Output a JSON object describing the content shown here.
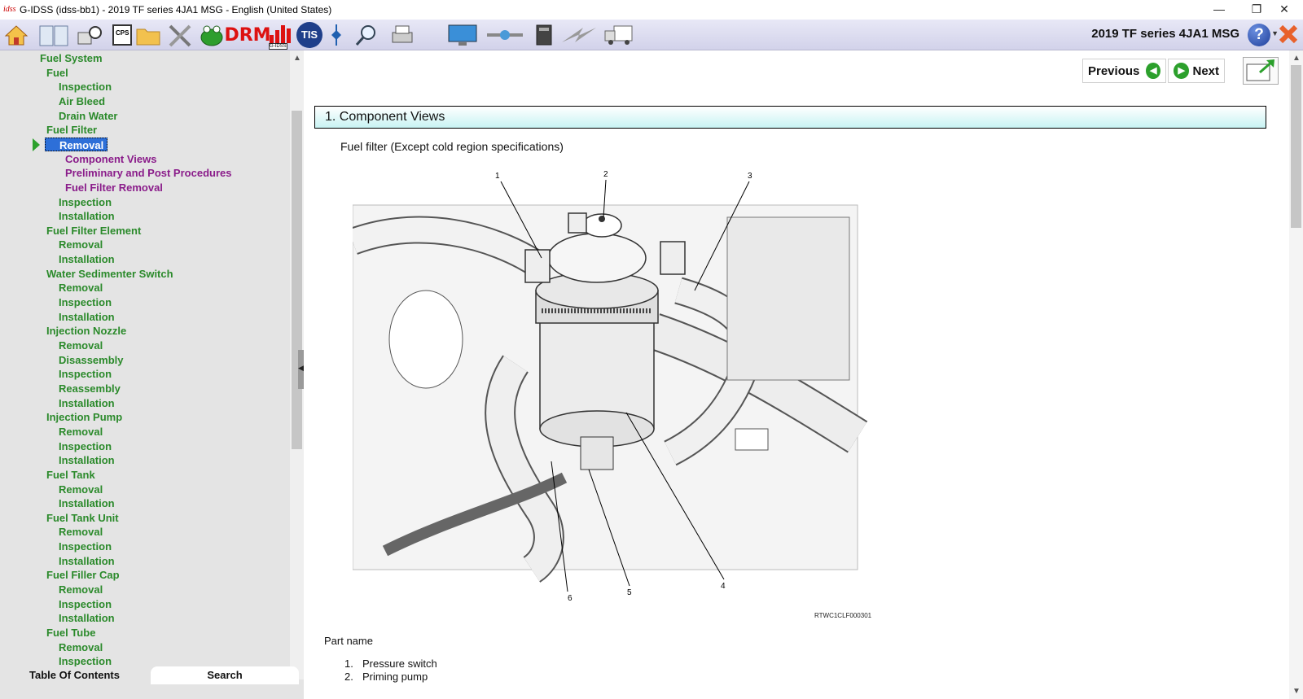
{
  "window": {
    "title": "G-IDSS (idss-bb1) - 2019 TF series 4JA1 MSG - English (United States)",
    "app_icon_text": "idss",
    "minimize": "—",
    "restore": "❐",
    "close": "✕"
  },
  "toolbar": {
    "model_title": "2019 TF series 4JA1 MSG",
    "drm_label": "DRM",
    "tis_label": "TIS",
    "gidss_label": "G-IDSS",
    "cps_label": "CPS",
    "help_label": "?",
    "icons": [
      "home-icon",
      "book-icon",
      "diagnostic-icon",
      "cps-icon",
      "folder-icon",
      "tools-icon",
      "frog-icon",
      "drm-icon",
      "bar-chart-icon",
      "tis-icon",
      "split-icon",
      "magnifier-icon",
      "printer-icon",
      "monitor-icon",
      "transfer-icon",
      "device-icon",
      "lightning-icon",
      "truck-icon"
    ]
  },
  "sidebar": {
    "tree": [
      {
        "label": "Fuel System",
        "level": 0
      },
      {
        "label": "Fuel",
        "level": 1
      },
      {
        "label": "Inspection",
        "level": 2
      },
      {
        "label": "Air Bleed",
        "level": 2
      },
      {
        "label": "Drain Water",
        "level": 2
      },
      {
        "label": "Fuel Filter",
        "level": 1
      },
      {
        "label": "Removal",
        "level": 2,
        "selected": true
      },
      {
        "label": "Component Views",
        "level": 3,
        "color": "purple"
      },
      {
        "label": "Preliminary and Post Procedures",
        "level": 3,
        "color": "purple"
      },
      {
        "label": "Fuel Filter Removal",
        "level": 3,
        "color": "purple"
      },
      {
        "label": "Inspection",
        "level": 2
      },
      {
        "label": "Installation",
        "level": 2
      },
      {
        "label": "Fuel Filter Element",
        "level": 1
      },
      {
        "label": "Removal",
        "level": 2
      },
      {
        "label": "Installation",
        "level": 2
      },
      {
        "label": "Water Sedimenter Switch",
        "level": 1
      },
      {
        "label": "Removal",
        "level": 2
      },
      {
        "label": "Inspection",
        "level": 2
      },
      {
        "label": "Installation",
        "level": 2
      },
      {
        "label": "Injection Nozzle",
        "level": 1
      },
      {
        "label": "Removal",
        "level": 2
      },
      {
        "label": "Disassembly",
        "level": 2
      },
      {
        "label": "Inspection",
        "level": 2
      },
      {
        "label": "Reassembly",
        "level": 2
      },
      {
        "label": "Installation",
        "level": 2
      },
      {
        "label": "Injection Pump",
        "level": 1
      },
      {
        "label": "Removal",
        "level": 2
      },
      {
        "label": "Inspection",
        "level": 2
      },
      {
        "label": "Installation",
        "level": 2
      },
      {
        "label": "Fuel Tank",
        "level": 1
      },
      {
        "label": "Removal",
        "level": 2
      },
      {
        "label": "Installation",
        "level": 2
      },
      {
        "label": "Fuel Tank Unit",
        "level": 1
      },
      {
        "label": "Removal",
        "level": 2
      },
      {
        "label": "Inspection",
        "level": 2
      },
      {
        "label": "Installation",
        "level": 2
      },
      {
        "label": "Fuel Filler Cap",
        "level": 1
      },
      {
        "label": "Removal",
        "level": 2
      },
      {
        "label": "Inspection",
        "level": 2
      },
      {
        "label": "Installation",
        "level": 2
      },
      {
        "label": "Fuel Tube",
        "level": 1
      },
      {
        "label": "Removal",
        "level": 2
      },
      {
        "label": "Inspection",
        "level": 2
      }
    ],
    "tabs": {
      "toc": "Table Of Contents",
      "search": "Search"
    }
  },
  "content": {
    "previous_label": "Previous",
    "next_label": "Next",
    "section_title": "1. Component Views",
    "caption": "Fuel filter (Except cold region specifications)",
    "figure_code": "RTWC1CLF000301",
    "callouts": [
      "1",
      "2",
      "3",
      "4",
      "5",
      "6"
    ],
    "part_name_label": "Part name",
    "parts": [
      {
        "num": "1.",
        "name": "Pressure switch"
      },
      {
        "num": "2.",
        "name": "Priming pump"
      }
    ]
  },
  "colors": {
    "tree_green": "#2b8a2b",
    "tree_purple": "#8a1c8a",
    "selection_blue": "#2d6fd8",
    "nav_green": "#2ca02c",
    "section_cyan": "#c8f3f3"
  }
}
